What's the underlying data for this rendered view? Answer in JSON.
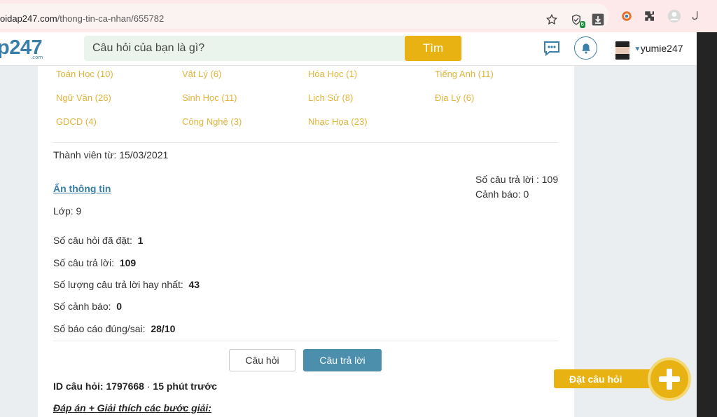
{
  "browser": {
    "url_host": "oidap247.com",
    "url_path": "/thong-tin-ca-nhan/655782",
    "ext_badge": "6",
    "edge_letter": "ل"
  },
  "header": {
    "logo": "p247",
    "logo_sub": ".com",
    "search_placeholder": "Câu hỏi của bạn là gì?",
    "search_button": "Tìm",
    "username": "yumie247"
  },
  "subjects": [
    [
      "Toán Học (10)",
      "Vật Lý (6)",
      "Hóa Học (1)",
      "Tiếng Anh (11)"
    ],
    [
      "Ngữ Văn (26)",
      "Sinh Học (11)",
      "Lịch Sử (8)",
      "Địa Lý (6)"
    ],
    [
      "GDCD (4)",
      "Công Nghệ (3)",
      "Nhạc Họa (23)"
    ]
  ],
  "profile": {
    "member_since": "Thành viên từ: 15/03/2021",
    "hide_info": "Ẩn thông tin",
    "grade": "Lớp: 9",
    "side_answers": "Số câu trả lời : 109",
    "side_warnings": "Cảnh báo: 0"
  },
  "stats": [
    {
      "label": "Số câu hỏi đã đặt:",
      "value": "1"
    },
    {
      "label": "Số câu trả lời:",
      "value": "109"
    },
    {
      "label": "Số lượng câu trả lời hay nhất:",
      "value": "43"
    },
    {
      "label": "Số cảnh báo:",
      "value": "0"
    },
    {
      "label": "Số báo cáo đúng/sai:",
      "value": "28/10"
    }
  ],
  "tabs": {
    "questions": "Câu hỏi",
    "answers": "Câu trả lời"
  },
  "question": {
    "id_line": "ID câu hỏi: 1797668",
    "separator": "·",
    "time": "15 phút trước",
    "answer_heading": "Đáp án + Giải thích các bước giải:"
  },
  "ask": {
    "label": "Đặt câu hỏi"
  },
  "colors": {
    "accent": "#e8b312",
    "brand": "#3a7fa9",
    "tab_active": "#4b8fac",
    "subject_link": "#e0b33a"
  }
}
